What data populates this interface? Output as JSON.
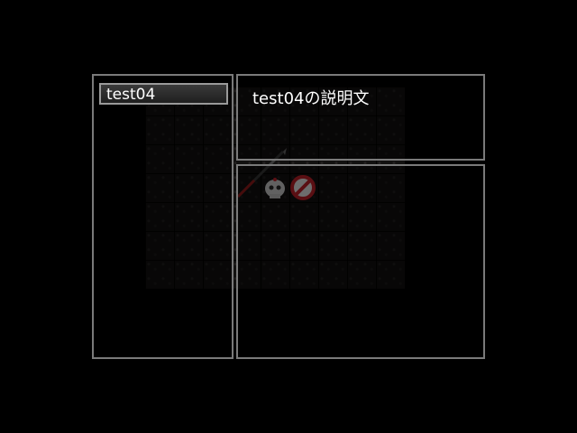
{
  "list": {
    "items": [
      {
        "label": "test04",
        "selected": true
      }
    ]
  },
  "description": {
    "text": "test04の説明文"
  },
  "map": {
    "sprites": [
      "spear-icon",
      "skull-icon",
      "forbidden-icon"
    ]
  },
  "colors": {
    "background": "#000000",
    "window_border": "#7a7a7a",
    "text": "#ffffff",
    "forbidden_red": "#c8222a"
  }
}
